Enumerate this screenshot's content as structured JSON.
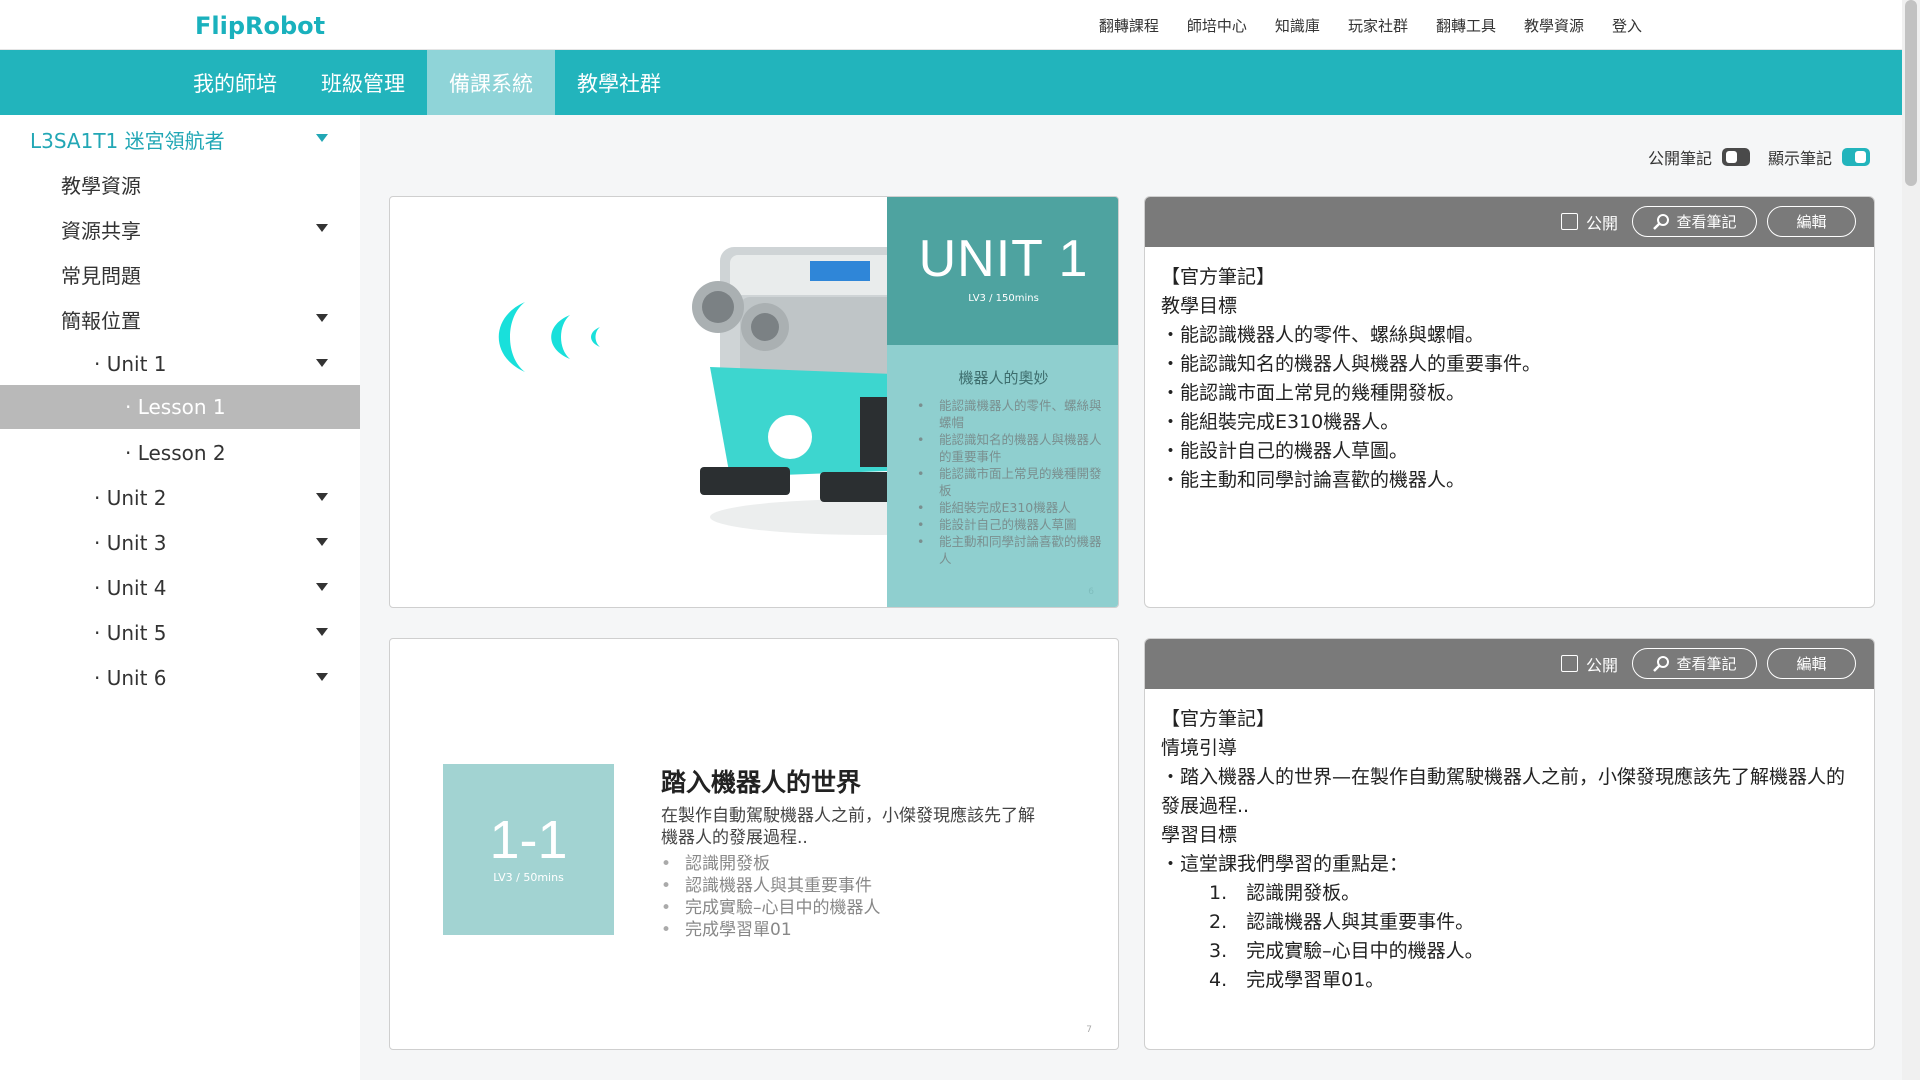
{
  "header": {
    "logo": "FlipRobot",
    "nav": [
      "翻轉課程",
      "師培中心",
      "知識庫",
      "玩家社群",
      "翻轉工具",
      "教學資源",
      "登入"
    ]
  },
  "tabs": [
    {
      "label": "我的師培"
    },
    {
      "label": "班級管理"
    },
    {
      "label": "備課系統",
      "active": true
    },
    {
      "label": "教學社群"
    }
  ],
  "sidebar": {
    "items": [
      {
        "label": "L3SA1T1 迷宮領航者"
      },
      {
        "label": "教學資源"
      },
      {
        "label": "資源共享"
      },
      {
        "label": "常見問題"
      },
      {
        "label": "簡報位置"
      },
      {
        "label": "· Unit 1"
      },
      {
        "label": "· Lesson 1",
        "active": true
      },
      {
        "label": "· Lesson 2"
      },
      {
        "label": "· Unit 2"
      },
      {
        "label": "· Unit 3"
      },
      {
        "label": "· Unit 4"
      },
      {
        "label": "· Unit 5"
      },
      {
        "label": "· Unit 6"
      }
    ]
  },
  "toggles": {
    "public_notes": {
      "label": "公開筆記",
      "on": false
    },
    "show_notes": {
      "label": "顯示筆記",
      "on": true
    }
  },
  "note_toolbar": {
    "public_label": "公開",
    "view_label": "查看筆記",
    "edit_label": "編輯"
  },
  "slides": [
    {
      "unit_title": "UNIT 1",
      "unit_sub": "LV3 / 150mins",
      "heading": "機器人的奧妙",
      "bullets": [
        "能認識機器人的零件、螺絲與螺帽",
        "能認識知名的機器人與機器人的重要事件",
        "能認識市面上常見的幾種開發板",
        "能組裝完成E310機器人",
        "能設計自己的機器人草圖",
        "能主動和同學討論喜歡的機器人"
      ],
      "page": "6"
    },
    {
      "code": "1-1",
      "code_sub": "LV3 / 50mins",
      "title": "踏入機器人的世界",
      "desc": "在製作自動駕駛機器人之前，小傑發現應該先了解機器人的發展過程..",
      "bullets": [
        "認識開發板",
        "認識機器人與其重要事件",
        "完成實驗–心目中的機器人",
        "完成學習單01"
      ],
      "page": "7"
    }
  ],
  "notes": [
    {
      "lines": [
        "【官方筆記】",
        "教學目標",
        "・能認識機器人的零件、螺絲與螺帽。",
        "・能認識知名的機器人與機器人的重要事件。",
        "・能認識市面上常見的幾種開發板。",
        "・能組裝完成E310機器人。",
        "・能設計自己的機器人草圖。",
        "・能主動和同學討論喜歡的機器人。"
      ]
    },
    {
      "lines": [
        "【官方筆記】",
        "情境引導",
        "・踏入機器人的世界—在製作自動駕駛機器人之前，小傑發現應該先了解機器人的發展過程..",
        "學習目標",
        "・這堂課我們學習的重點是："
      ],
      "ordered": [
        "1.　認識開發板。",
        "2.　認識機器人與其重要事件。",
        "3.　完成實驗–心目中的機器人。",
        "4.　完成學習單01。"
      ]
    }
  ],
  "colors": {
    "teal": "#22b4bc",
    "active_tab": "#8fd4d8",
    "note_header": "#7a7a7a",
    "sidebar_active": "#b9b9b9"
  }
}
